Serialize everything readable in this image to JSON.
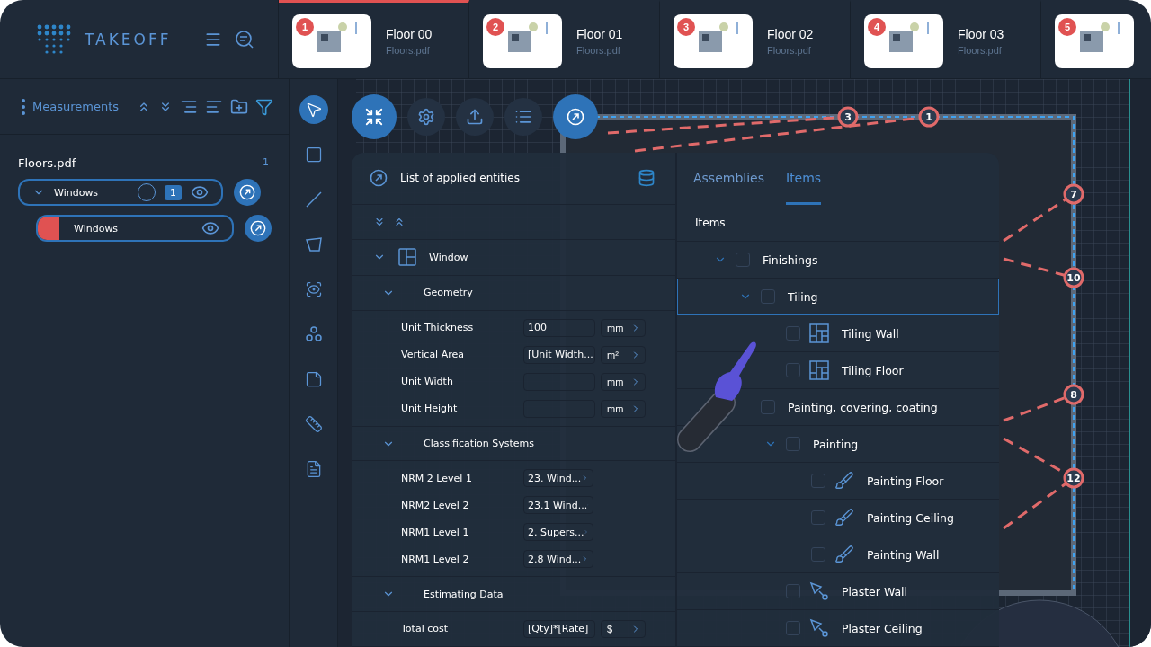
{
  "brand": {
    "name": "TAKEOFF"
  },
  "floors": [
    {
      "index": "1",
      "title": "Floor 00",
      "file": "Floors.pdf",
      "selected": true
    },
    {
      "index": "2",
      "title": "Floor 01",
      "file": "Floors.pdf",
      "selected": false
    },
    {
      "index": "3",
      "title": "Floor 02",
      "file": "Floors.pdf",
      "selected": false
    },
    {
      "index": "4",
      "title": "Floor 03",
      "file": "Floors.pdf",
      "selected": false
    },
    {
      "index": "5",
      "selected": false
    }
  ],
  "sidebar": {
    "title": "Measurements",
    "file": {
      "name": "Floors.pdf",
      "count": "1"
    },
    "groups": [
      {
        "name": "Windows",
        "count": "1",
        "expanded": true,
        "children": [
          {
            "name": "Windows",
            "color": "#e05252"
          }
        ]
      }
    ]
  },
  "tools": [
    {
      "kind": "select",
      "selected": true
    },
    {
      "kind": "rectangle",
      "selected": false
    },
    {
      "kind": "line",
      "selected": false
    },
    {
      "kind": "polygon",
      "selected": false
    },
    {
      "kind": "inspect",
      "selected": false
    },
    {
      "kind": "count",
      "selected": false
    },
    {
      "kind": "note",
      "selected": false
    },
    {
      "kind": "ruler",
      "selected": false
    },
    {
      "kind": "document",
      "selected": false
    }
  ],
  "canvas_toolbar": [
    {
      "kind": "collapse",
      "active": true
    },
    {
      "kind": "settings",
      "active": false
    },
    {
      "kind": "upload",
      "active": false
    },
    {
      "kind": "list",
      "active": false
    },
    {
      "kind": "link",
      "active": true
    }
  ],
  "markers": [
    {
      "label": "3"
    },
    {
      "label": "1"
    },
    {
      "label": "7"
    },
    {
      "label": "10"
    },
    {
      "label": "8"
    },
    {
      "label": "12"
    }
  ],
  "entities": {
    "title": "List of applied entities",
    "entity": "Window",
    "sections": [
      {
        "title": "Geometry",
        "rows": [
          {
            "label": "Unit Thickness",
            "value": "100",
            "unit": "mm"
          },
          {
            "label": "Vertical Area",
            "value": "[Unit Width...",
            "unit": "m²"
          },
          {
            "label": "Unit Width",
            "value": "",
            "unit": "mm"
          },
          {
            "label": "Unit Height",
            "value": "",
            "unit": "mm"
          }
        ]
      },
      {
        "title": "Classification Systems",
        "rows": [
          {
            "label": "NRM 2 Level 1",
            "value": "23. Wind..."
          },
          {
            "label": "NRM2 Level 2",
            "value": "23.1 Wind..."
          },
          {
            "label": "NRM1 Level 1",
            "value": "2. Supers..."
          },
          {
            "label": "NRM1 Level 2",
            "value": "2.8 Wind..."
          }
        ]
      },
      {
        "title": "Estimating Data",
        "rows": [
          {
            "label": "Total cost",
            "value": "[Qty]*[Rate]",
            "unit": "$"
          }
        ]
      }
    ]
  },
  "library": {
    "tabs": [
      {
        "label": "Assemblies",
        "selected": false
      },
      {
        "label": "Items",
        "selected": true
      }
    ],
    "heading": "Items",
    "tree": [
      {
        "label": "Finishings",
        "expanded": true,
        "selected": false,
        "children": [
          {
            "label": "Tiling",
            "expanded": true,
            "selected": true,
            "children": [
              {
                "label": "Tiling Wall",
                "kind": "tiles",
                "selected": false
              },
              {
                "label": "Tiling Floor",
                "kind": "tiles",
                "selected": false
              }
            ]
          },
          {
            "label": "Painting, covering, coating",
            "selected": false,
            "children": [
              {
                "label": "Painting",
                "expanded": true,
                "selected": false,
                "children": [
                  {
                    "label": "Painting Floor",
                    "kind": "brush",
                    "selected": false
                  },
                  {
                    "label": "Painting Ceiling",
                    "kind": "brush",
                    "selected": false
                  },
                  {
                    "label": "Painting Wall",
                    "kind": "brush",
                    "selected": false
                  }
                ]
              },
              {
                "label": "Plaster Wall",
                "kind": "trowel",
                "selected": false
              },
              {
                "label": "Plaster Ceiling",
                "kind": "trowel",
                "selected": false
              }
            ]
          }
        ]
      }
    ]
  }
}
